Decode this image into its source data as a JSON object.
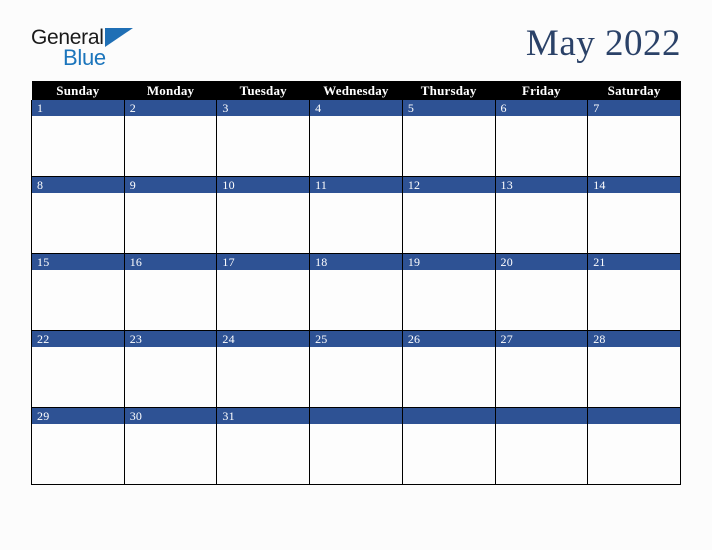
{
  "brand": {
    "name_part1": "General",
    "name_part2": "Blue",
    "triangle_icon": "triangle-icon",
    "color_dark": "#1a1a1a",
    "color_blue": "#1b75bc"
  },
  "title": {
    "month_year": "May 2022",
    "color": "#2b4268"
  },
  "calendar": {
    "month": "May",
    "year": "2022",
    "accent_color": "#2e5294",
    "header_bg": "#000000",
    "header_text_color": "#ffffff",
    "weekdays": [
      "Sunday",
      "Monday",
      "Tuesday",
      "Wednesday",
      "Thursday",
      "Friday",
      "Saturday"
    ],
    "weeks": [
      [
        "1",
        "2",
        "3",
        "4",
        "5",
        "6",
        "7"
      ],
      [
        "8",
        "9",
        "10",
        "11",
        "12",
        "13",
        "14"
      ],
      [
        "15",
        "16",
        "17",
        "18",
        "19",
        "20",
        "21"
      ],
      [
        "22",
        "23",
        "24",
        "25",
        "26",
        "27",
        "28"
      ],
      [
        "29",
        "30",
        "31",
        "",
        "",
        "",
        ""
      ]
    ]
  }
}
